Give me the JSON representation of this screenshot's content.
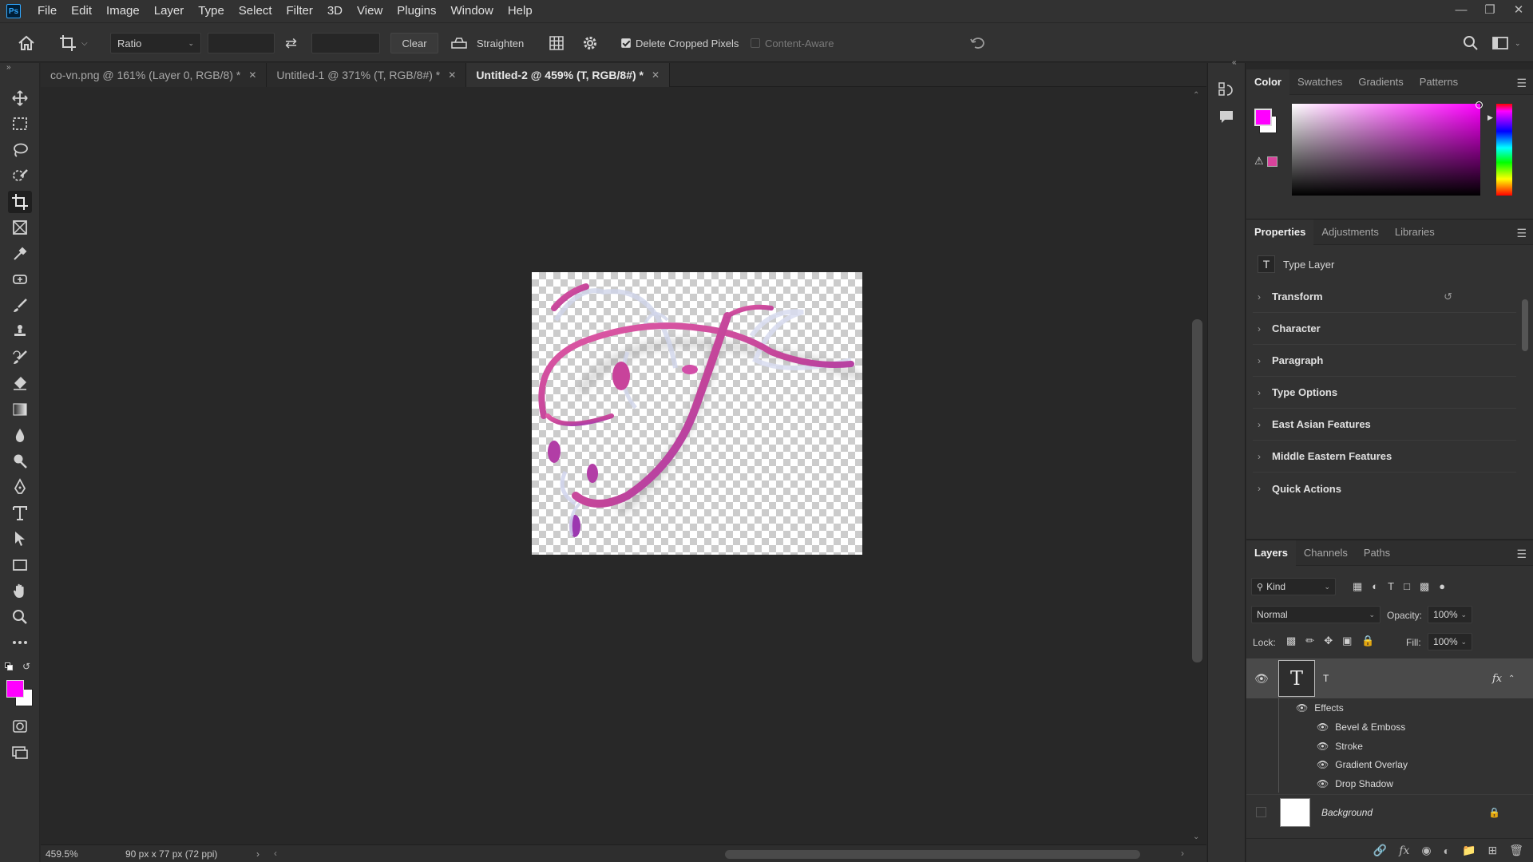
{
  "menubar": {
    "logo": "Ps",
    "items": [
      "File",
      "Edit",
      "Image",
      "Layer",
      "Type",
      "Select",
      "Filter",
      "3D",
      "View",
      "Plugins",
      "Window",
      "Help"
    ]
  },
  "options": {
    "ratio_label": "Ratio",
    "clear_label": "Clear",
    "straighten_label": "Straighten",
    "delete_cropped_label": "Delete Cropped Pixels",
    "delete_cropped_checked": true,
    "content_aware_label": "Content-Aware",
    "content_aware_checked": false
  },
  "tabs": [
    {
      "label": "co-vn.png @ 161% (Layer 0, RGB/8) *",
      "active": false
    },
    {
      "label": "Untitled-1 @ 371% (T, RGB/8#) *",
      "active": false
    },
    {
      "label": "Untitled-2 @ 459% (T, RGB/8#) *",
      "active": true
    }
  ],
  "status": {
    "zoom": "459.5%",
    "doc_info": "90 px x 77 px (72 ppi)"
  },
  "colors": {
    "foreground": "#ff00ff",
    "background": "#ffffff",
    "accent_pink": "#d8439c"
  },
  "color_panel": {
    "tabs": [
      "Color",
      "Swatches",
      "Gradients",
      "Patterns"
    ]
  },
  "properties_panel": {
    "tabs": [
      "Properties",
      "Adjustments",
      "Libraries"
    ],
    "type_layer_label": "Type Layer",
    "sections": [
      "Transform",
      "Character",
      "Paragraph",
      "Type Options",
      "East Asian Features",
      "Middle Eastern Features",
      "Quick Actions"
    ]
  },
  "layers_panel": {
    "tabs": [
      "Layers",
      "Channels",
      "Paths"
    ],
    "kind_label": "Kind",
    "blend_mode": "Normal",
    "opacity_label": "Opacity:",
    "opacity_value": "100%",
    "lock_label": "Lock:",
    "fill_label": "Fill:",
    "fill_value": "100%",
    "type_layer_name": "T",
    "fx_label": "fx",
    "effects_label": "Effects",
    "effects": [
      "Bevel & Emboss",
      "Stroke",
      "Gradient Overlay",
      "Drop Shadow"
    ],
    "background_layer_name": "Background"
  }
}
